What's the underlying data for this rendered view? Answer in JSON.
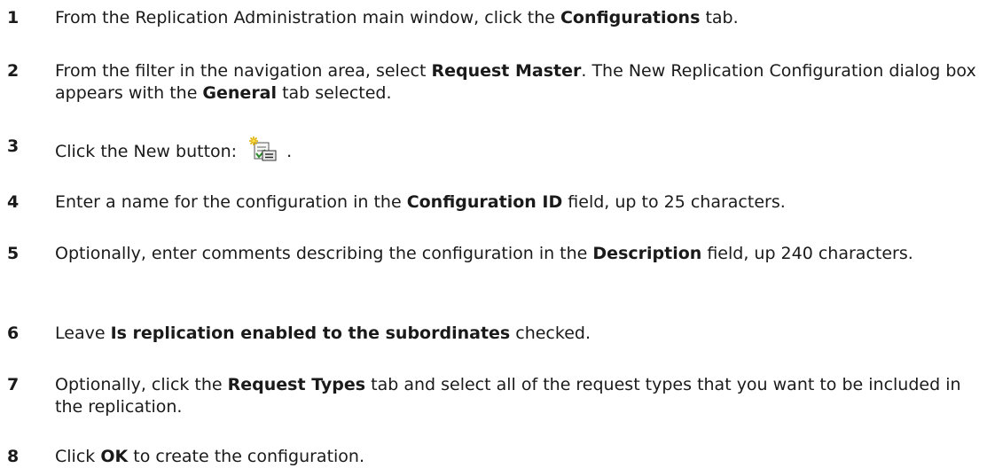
{
  "steps": [
    {
      "number": "1",
      "parts": [
        {
          "text": "From the Replication Administration main window, click the "
        },
        {
          "text": "Configurations",
          "bold": true
        },
        {
          "text": " tab."
        }
      ]
    },
    {
      "number": "2",
      "parts": [
        {
          "text": "From the filter in the navigation area, select "
        },
        {
          "text": "Request Master",
          "bold": true
        },
        {
          "text": ". The New Replication Configuration dialog box appears with the "
        },
        {
          "text": "General",
          "bold": true
        },
        {
          "text": " tab selected."
        }
      ]
    },
    {
      "number": "3",
      "parts": [
        {
          "text": "Click the New button: "
        },
        {
          "icon": "new-configuration-icon"
        },
        {
          "text": " ."
        }
      ]
    },
    {
      "number": "4",
      "parts": [
        {
          "text": "Enter a name for the configuration in the "
        },
        {
          "text": "Configuration ID",
          "bold": true
        },
        {
          "text": " field, up to 25 characters."
        }
      ]
    },
    {
      "number": "5",
      "parts": [
        {
          "text": "Optionally, enter comments describing the configuration in the "
        },
        {
          "text": "Description",
          "bold": true
        },
        {
          "text": " field, up 240 characters."
        }
      ]
    },
    {
      "number": "6",
      "parts": [
        {
          "text": "Leave "
        },
        {
          "text": "Is replication enabled to the subordinates",
          "bold": true
        },
        {
          "text": " checked."
        }
      ]
    },
    {
      "number": "7",
      "parts": [
        {
          "text": "Optionally, click the "
        },
        {
          "text": "Request Types",
          "bold": true
        },
        {
          "text": " tab and select all of the request types that you want to be included in the replication."
        }
      ]
    },
    {
      "number": "8",
      "parts": [
        {
          "text": "Click "
        },
        {
          "text": "OK",
          "bold": true
        },
        {
          "text": " to create the configuration."
        }
      ]
    }
  ]
}
